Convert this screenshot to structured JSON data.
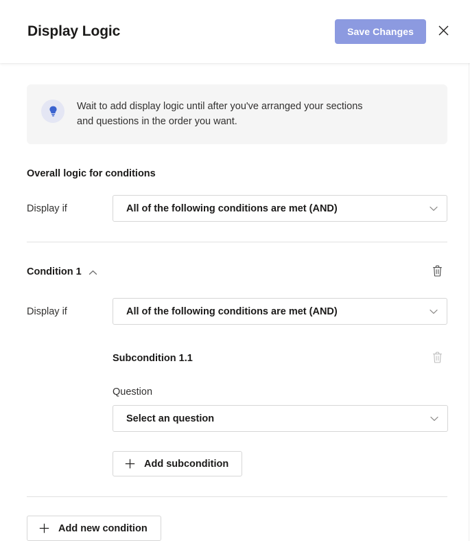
{
  "header": {
    "title": "Display Logic",
    "save_label": "Save Changes",
    "close_icon": "close-icon"
  },
  "banner": {
    "icon": "lightbulb-icon",
    "text": "Wait to add display logic until after you've arranged your sections and questions in the order you want."
  },
  "overall": {
    "heading": "Overall logic for conditions",
    "display_if_label": "Display if",
    "logic_value": "All of the following conditions are met (AND)",
    "chevron_icon": "chevron-down-icon"
  },
  "condition": {
    "title": "Condition 1",
    "collapse_icon": "chevron-up-icon",
    "delete_icon": "trash-icon",
    "display_if_label": "Display if",
    "logic_value": "All of the following conditions are met (AND)",
    "chevron_icon": "chevron-down-icon",
    "subcondition": {
      "title": "Subcondition 1.1",
      "delete_icon": "trash-icon",
      "question_label": "Question",
      "question_value": "Select an question",
      "chevron_icon": "chevron-down-icon"
    },
    "add_subcondition_label": "Add subcondition"
  },
  "footer": {
    "add_condition_label": "Add new condition"
  },
  "colors": {
    "accent": "#8c9ae0",
    "bulb_blue": "#3b63cf",
    "bulb_circle": "#e4e6f4",
    "banner_bg": "#f5f5f5",
    "border": "#d6d6d6",
    "divider": "#e1e1e1",
    "text": "#1b1a19"
  }
}
